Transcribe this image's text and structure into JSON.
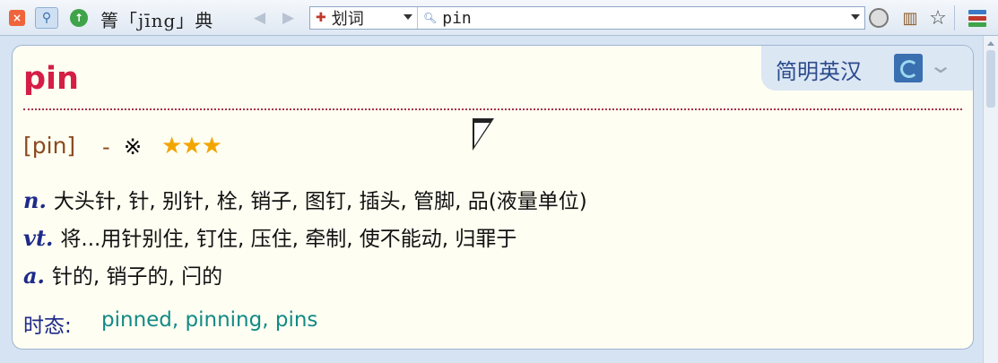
{
  "toolbar": {
    "close_icon": "close-icon",
    "pin_icon": "pin-icon",
    "up_icon": "up-arrow-icon",
    "app_title": "箐「jīng」典",
    "back_icon": "left-arrow-icon",
    "forward_icon": "right-arrow-icon",
    "mode_label": "划词",
    "search_value": "pin",
    "speaker_icon": "speaker-icon",
    "book_icon": "book-icon",
    "star_glyph": "☆",
    "books_icon": "books-icon"
  },
  "card": {
    "dict_name": "简明英汉",
    "word": "pin",
    "phonetic": "[pin]",
    "dash": "-",
    "mark": "※",
    "stars": "★★★",
    "definitions": [
      {
        "pos": "n.",
        "text": "大头针, 针, 别针, 栓, 销子, 图钉, 插头, 管脚, 品(液量单位)"
      },
      {
        "pos": "vt.",
        "text": "将...用针别住, 钉住, 压住, 牵制, 使不能动, 归罪于"
      },
      {
        "pos": "a.",
        "text": "针的, 销子的, 闩的"
      }
    ],
    "tense_label": "时态:",
    "tense_forms": "pinned, pinning, pins"
  },
  "colors": {
    "word": "#d41e46",
    "phonetic": "#8b4a1f",
    "pos": "#1e2a8a",
    "forms": "#118a86",
    "stars": "#f2a500"
  }
}
